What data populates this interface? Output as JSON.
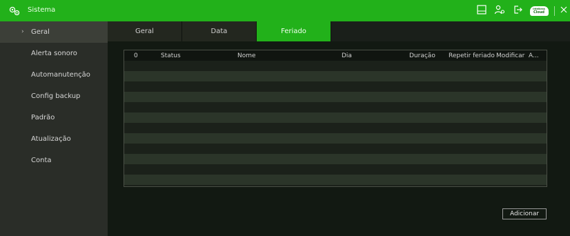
{
  "window": {
    "title": "Sistema",
    "accent": "#22b11a"
  },
  "toolbar": {
    "icons": [
      "faq-icon",
      "user-settings-icon",
      "logout-icon",
      "cloud-icon",
      "close-icon"
    ],
    "faq_label": "FAQ",
    "cloud_label_top": "Intelbras",
    "cloud_label_bottom": "Cloud"
  },
  "sidebar": {
    "items": [
      {
        "label": "Geral",
        "active": true
      },
      {
        "label": "Alerta sonoro"
      },
      {
        "label": "Automanutenção"
      },
      {
        "label": "Config backup"
      },
      {
        "label": "Padrão"
      },
      {
        "label": "Atualização"
      },
      {
        "label": "Conta"
      }
    ]
  },
  "tabs": [
    {
      "label": "Geral"
    },
    {
      "label": "Data"
    },
    {
      "label": "Feriado",
      "active": true
    }
  ],
  "table": {
    "columns": [
      "0",
      "Status",
      "Nome",
      "Dia",
      "Duração",
      "Repetir feriado",
      "Modificar",
      "A..."
    ],
    "rows": []
  },
  "actions": {
    "add_label": "Adicionar"
  }
}
